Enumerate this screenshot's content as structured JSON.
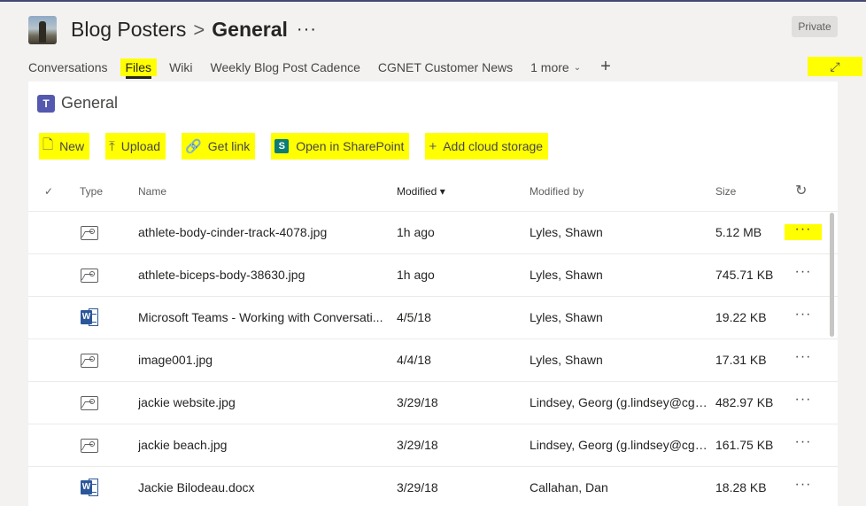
{
  "header": {
    "team_name": "Blog Posters",
    "separator": ">",
    "channel_name": "General",
    "more_glyph": "···",
    "privacy_badge": "Private"
  },
  "tabs": [
    {
      "label": "Conversations",
      "active": false,
      "highlighted": false
    },
    {
      "label": "Files",
      "active": true,
      "highlighted": true
    },
    {
      "label": "Wiki",
      "active": false,
      "highlighted": false
    },
    {
      "label": "Weekly Blog Post Cadence",
      "active": false,
      "highlighted": false
    },
    {
      "label": "CGNET Customer News",
      "active": false,
      "highlighted": false
    }
  ],
  "tabs_more": {
    "label": "1 more",
    "chevron": "v"
  },
  "tab_add_glyph": "+",
  "expand_glyph": "⤢",
  "library": {
    "title": "General",
    "logo_glyph": "T"
  },
  "commands": [
    {
      "label": "New",
      "icon": "new-file-icon",
      "glyph": "🗋"
    },
    {
      "label": "Upload",
      "icon": "upload-icon",
      "glyph": "⤒"
    },
    {
      "label": "Get link",
      "icon": "link-icon",
      "glyph": "🔗"
    },
    {
      "label": "Open in SharePoint",
      "icon": "sharepoint-icon",
      "glyph": "S"
    },
    {
      "label": "Add cloud storage",
      "icon": "plus-icon",
      "glyph": "+"
    }
  ],
  "table": {
    "headers": {
      "check": "✓",
      "type": "Type",
      "name": "Name",
      "modified": "Modified",
      "modified_sort": "▾",
      "modified_by": "Modified by",
      "size": "Size",
      "refresh": "↻"
    },
    "rows": [
      {
        "type": "image",
        "name": "athlete-body-cinder-track-4078.jpg",
        "modified": "1h ago",
        "modified_by": "Lyles, Shawn",
        "size": "5.12 MB",
        "more": "···"
      },
      {
        "type": "image",
        "name": "athlete-biceps-body-38630.jpg",
        "modified": "1h ago",
        "modified_by": "Lyles, Shawn",
        "size": "745.71 KB",
        "more": "···"
      },
      {
        "type": "word",
        "name": "Microsoft Teams - Working with Conversati...",
        "modified": "4/5/18",
        "modified_by": "Lyles, Shawn",
        "size": "19.22 KB",
        "more": "···"
      },
      {
        "type": "image",
        "name": "image001.jpg",
        "modified": "4/4/18",
        "modified_by": "Lyles, Shawn",
        "size": "17.31 KB",
        "more": "···"
      },
      {
        "type": "image",
        "name": "jackie website.jpg",
        "modified": "3/29/18",
        "modified_by": "Lindsey, Georg (g.lindsey@cgn...",
        "size": "482.97 KB",
        "more": "···"
      },
      {
        "type": "image",
        "name": "jackie beach.jpg",
        "modified": "3/29/18",
        "modified_by": "Lindsey, Georg (g.lindsey@cgn...",
        "size": "161.75 KB",
        "more": "···"
      },
      {
        "type": "word",
        "name": "Jackie Bilodeau.docx",
        "modified": "3/29/18",
        "modified_by": "Callahan, Dan",
        "size": "18.28 KB",
        "more": "···"
      }
    ]
  },
  "colors": {
    "highlight": "#ffff00",
    "teams_purple": "#5558af",
    "word_blue": "#2b579a",
    "sharepoint_teal": "#0b7c76"
  }
}
